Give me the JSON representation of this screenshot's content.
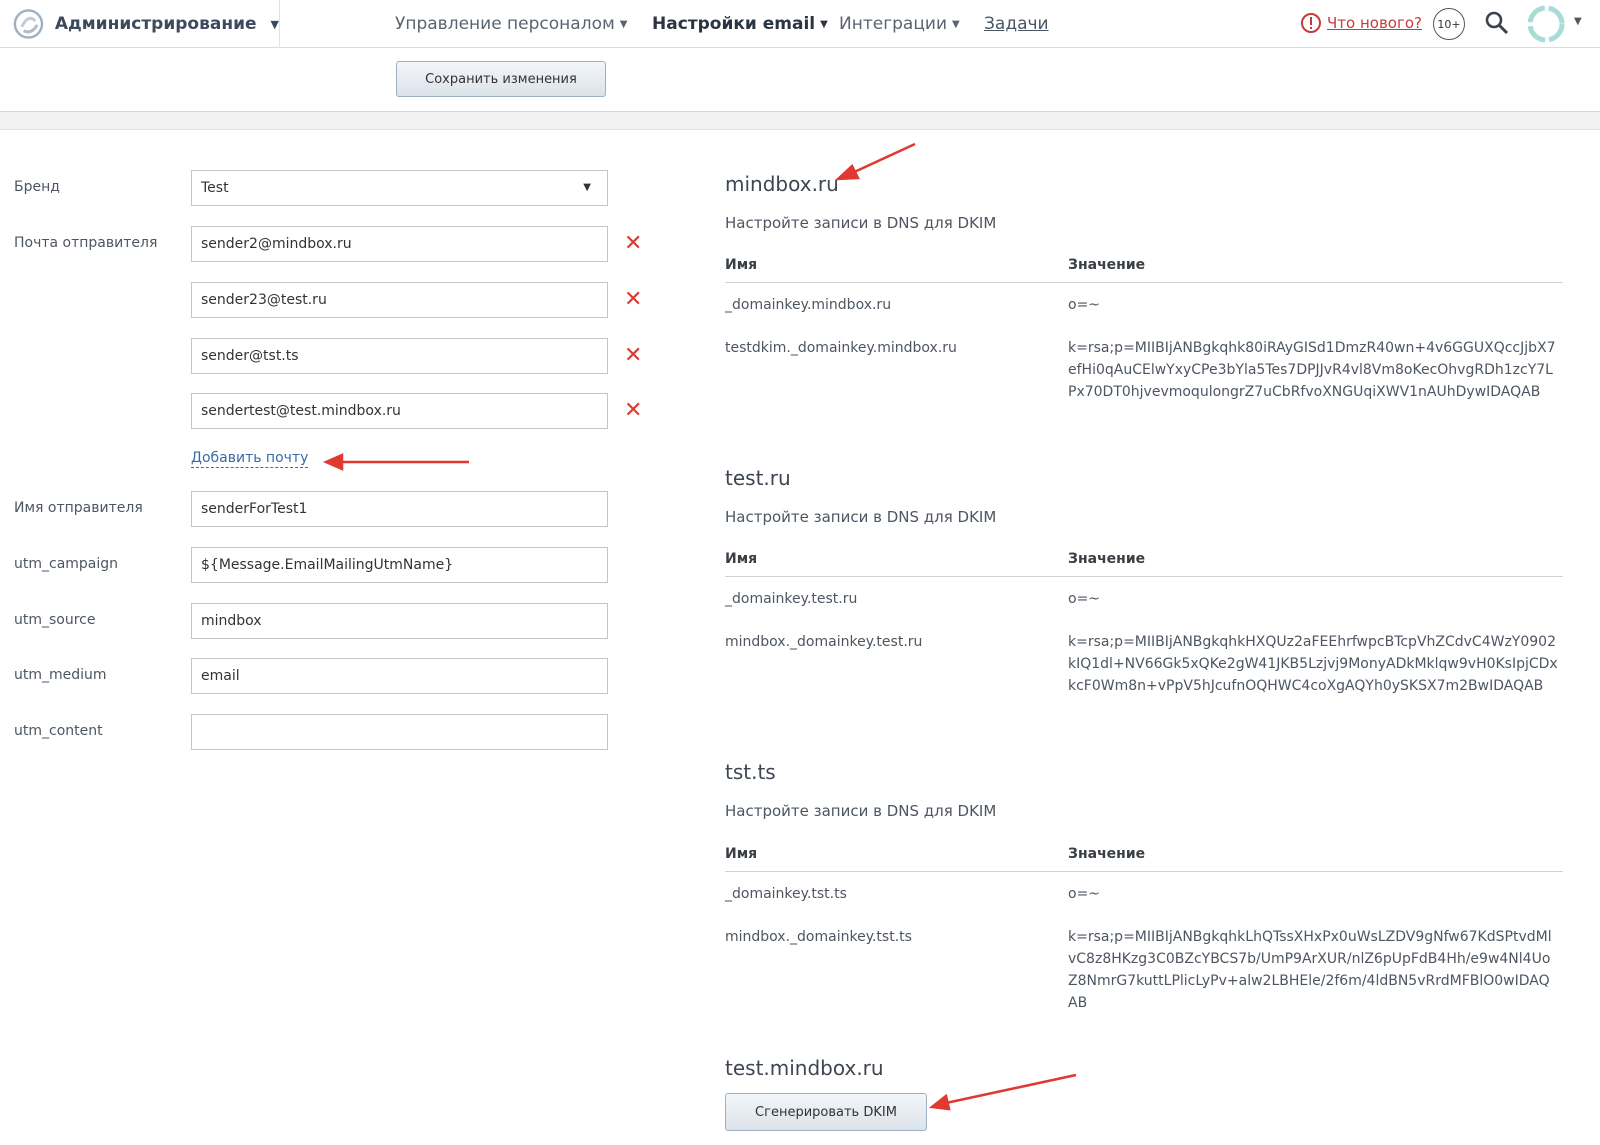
{
  "header": {
    "brand_title": "Администрирование",
    "nav": [
      {
        "label": "Управление персоналом"
      },
      {
        "label": "Настройки email"
      },
      {
        "label": "Интеграции"
      },
      {
        "label": "Задачи"
      }
    ],
    "whats_new": "Что нового?",
    "badge": "10+",
    "icons": {
      "logo": "mindbox-logo-icon",
      "search": "search-icon",
      "avatar": "user-avatar-icon",
      "alert": "alert-circle-icon"
    }
  },
  "toolbar": {
    "save_label": "Сохранить изменения"
  },
  "form": {
    "brand_label": "Бренд",
    "brand_value": "Test",
    "sender_email_label": "Почта отправителя",
    "emails": [
      "sender2@mindbox.ru",
      "sender23@test.ru",
      "sender@tst.ts",
      "sendertest@test.mindbox.ru"
    ],
    "add_email": "Добавить почту",
    "sender_name_label": "Имя отправителя",
    "sender_name": "senderForTest1",
    "utm": [
      {
        "label": "utm_campaign",
        "value": "${Message.EmailMailingUtmName}"
      },
      {
        "label": "utm_source",
        "value": "mindbox"
      },
      {
        "label": "utm_medium",
        "value": "email"
      },
      {
        "label": "utm_content",
        "value": ""
      }
    ]
  },
  "dns": {
    "subtitle": "Настройте записи в DNS для DKIM",
    "col_name": "Имя",
    "col_value": "Значение",
    "domains": [
      {
        "name": "mindbox.ru",
        "rows": [
          {
            "name": "_domainkey.mindbox.ru",
            "value": "o=~"
          },
          {
            "name": "testdkim._domainkey.mindbox.ru",
            "value": "k=rsa;p=MIIBIjANBgkqhk80iRAyGISd1DmzR40wn+4v6GGUXQccJjbX7efHi0qAuCElwYxyCPe3bYla5Tes7DPJJvR4vl8Vm8oKecOhvgRDh1zcY7LPx70DT0hjvevmoqulongrZ7uCbRfvoXNGUqiXWV1nAUhDywIDAQAB"
          }
        ]
      },
      {
        "name": "test.ru",
        "rows": [
          {
            "name": "_domainkey.test.ru",
            "value": "o=~"
          },
          {
            "name": "mindbox._domainkey.test.ru",
            "value": "k=rsa;p=MIIBIjANBgkqhkHXQUz2aFEEhrfwpcBTcpVhZCdvC4WzY0902kIQ1dl+NV66Gk5xQKe2gW41JKB5Lzjvj9MonyADkMklqw9vH0KsIpjCDxkcF0Wm8n+vPpV5hJcufnOQHWC4coXgAQYh0ySKSX7m2BwIDAQAB"
          }
        ]
      },
      {
        "name": "tst.ts",
        "rows": [
          {
            "name": "_domainkey.tst.ts",
            "value": "o=~"
          },
          {
            "name": "mindbox._domainkey.tst.ts",
            "value": "k=rsa;p=MIIBIjANBgkqhkLhQTssXHxPx0uWsLZDV9gNfw67KdSPtvdMlvC8z8HKzg3C0BZcYBCS7b/UmP9ArXUR/nlZ6pUpFdB4Hh/e9w4Nl4UoZ8NmrG7kuttLPlicLyPv+alw2LBHEle/2f6m/4ldBN5vRrdMFBlO0wIDAQAB"
          }
        ]
      }
    ],
    "pending_domain": "test.mindbox.ru",
    "generate_label": "Сгенерировать DKIM"
  },
  "colors": {
    "accent_red": "#e0392f",
    "link": "#3a6ba8",
    "nav_text": "#5a6471"
  }
}
